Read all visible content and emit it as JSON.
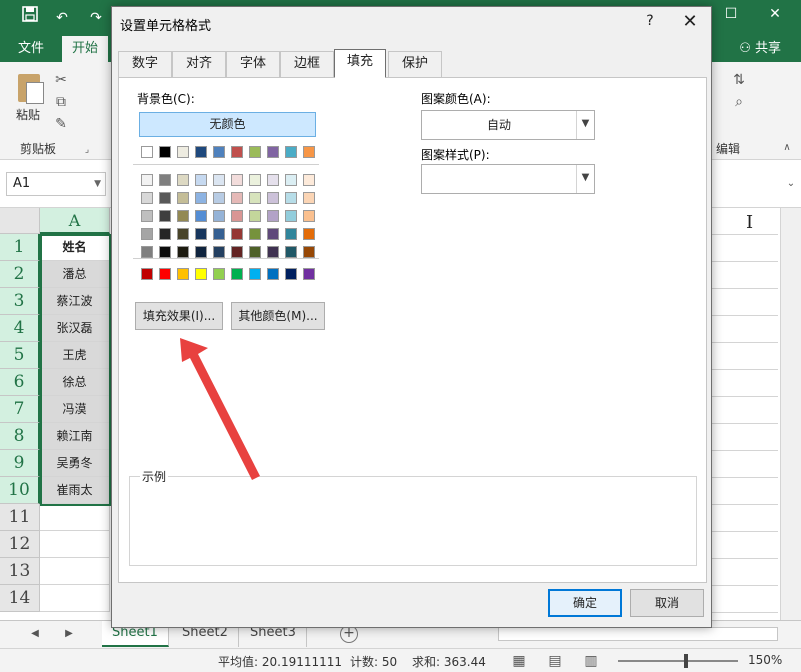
{
  "excel": {
    "qat_icons": [
      "save-icon",
      "undo-icon",
      "redo-icon"
    ],
    "tabs": [
      "文件",
      "开始"
    ],
    "share_label": "共享",
    "ribbon": {
      "paste_label": "粘贴",
      "clipboard_label": "剪贴板",
      "edit_label": "编辑"
    },
    "name_box": "A1",
    "column_header": "A",
    "rows": [
      {
        "n": "1",
        "value": "姓名"
      },
      {
        "n": "2",
        "value": "潘总"
      },
      {
        "n": "3",
        "value": "蔡江波"
      },
      {
        "n": "4",
        "value": "张汉磊"
      },
      {
        "n": "5",
        "value": "王虎"
      },
      {
        "n": "6",
        "value": "徐总"
      },
      {
        "n": "7",
        "value": "冯漠"
      },
      {
        "n": "8",
        "value": "赖江南"
      },
      {
        "n": "9",
        "value": "吴勇冬"
      },
      {
        "n": "10",
        "value": "崔雨太"
      },
      {
        "n": "11",
        "value": ""
      },
      {
        "n": "12",
        "value": ""
      },
      {
        "n": "13",
        "value": ""
      },
      {
        "n": "14",
        "value": ""
      }
    ],
    "sheets": [
      "Sheet1",
      "Sheet2",
      "Sheet3"
    ],
    "status": {
      "average": "平均值: 20.19111111",
      "count": "计数: 50",
      "sum": "求和: 363.44",
      "zoom": "150%"
    },
    "accent_color": "#217346"
  },
  "dialog": {
    "title": "设置单元格格式",
    "help": "?",
    "tabs": [
      "数字",
      "对齐",
      "字体",
      "边框",
      "填充",
      "保护"
    ],
    "active_tab": "填充",
    "background_color_label": "背景色(C):",
    "no_color": "无颜色",
    "pattern_color_label": "图案颜色(A):",
    "pattern_color_value": "自动",
    "pattern_style_label": "图案样式(P):",
    "fill_effects_button": "填充效果(I)...",
    "more_colors_button": "其他颜色(M)...",
    "sample_label": "示例",
    "ok_button": "确定",
    "cancel_button": "取消",
    "palette_top": [
      "#ffffff",
      "#000000",
      "#eeece1",
      "#1f497d",
      "#4f81bd",
      "#c0504d",
      "#9bbb59",
      "#8064a2",
      "#4bacc6",
      "#f79646"
    ],
    "palette_shades": [
      [
        "#f2f2f2",
        "#7f7f7f",
        "#ddd9c3",
        "#c6d9f0",
        "#dbe5f1",
        "#f2dcdb",
        "#ebf1dd",
        "#e5e0ec",
        "#dbeef3",
        "#fdeada"
      ],
      [
        "#d8d8d8",
        "#595959",
        "#c4bd97",
        "#8db3e2",
        "#b8cce4",
        "#e5b9b7",
        "#d7e3bc",
        "#ccc1d9",
        "#b7dde8",
        "#fbd5b5"
      ],
      [
        "#bfbfbf",
        "#3f3f3f",
        "#938953",
        "#548dd4",
        "#95b3d7",
        "#d99694",
        "#c3d69b",
        "#b2a2c7",
        "#92cddc",
        "#fac08f"
      ],
      [
        "#a5a5a5",
        "#262626",
        "#494429",
        "#17365d",
        "#366092",
        "#953734",
        "#76923c",
        "#5f497a",
        "#31859b",
        "#e36c09"
      ],
      [
        "#7f7f7f",
        "#0c0c0c",
        "#1d1b10",
        "#0f243e",
        "#244061",
        "#632423",
        "#4f6128",
        "#3f3151",
        "#205867",
        "#974806"
      ]
    ],
    "palette_standard": [
      "#c00000",
      "#ff0000",
      "#ffc000",
      "#ffff00",
      "#92d050",
      "#00b050",
      "#00b0f0",
      "#0070c0",
      "#002060",
      "#7030a0"
    ],
    "annotation_color": "#e8413f"
  }
}
